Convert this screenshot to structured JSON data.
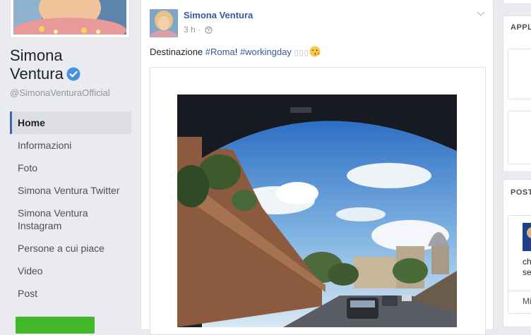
{
  "profile": {
    "name_line1": "Simona",
    "name_line2": "Ventura",
    "handle": "@SimonaVenturaOfficial"
  },
  "nav": {
    "items": [
      {
        "label": "Home"
      },
      {
        "label": "Informazioni"
      },
      {
        "label": "Foto"
      },
      {
        "label": "Simona Ventura Twitter"
      },
      {
        "label": "Simona Ventura Instagram"
      },
      {
        "label": "Persone a cui piace"
      },
      {
        "label": "Video"
      },
      {
        "label": "Post"
      }
    ],
    "active_index": 0
  },
  "post": {
    "author": "Simona Ventura",
    "time": "3 h",
    "separator": "·",
    "text_prefix": "Destinazione ",
    "hashtag1": "#Roma",
    "text_middle": "! ",
    "hashtag2": "#workingday",
    "emoji_placeholder": "▯▯▯"
  },
  "right": {
    "heading1": "APPL",
    "heading2": "POST",
    "snippet_line1": "che",
    "snippet_line2": "sec",
    "link": "Mi"
  },
  "colors": {
    "link": "#365899",
    "accent": "#4267b2",
    "cta_green": "#42b72a",
    "background": "#e9ebee"
  },
  "icons": [
    "verified-badge-icon",
    "globe-icon",
    "chevron-down-icon",
    "winking-kiss-emoji-icon"
  ]
}
